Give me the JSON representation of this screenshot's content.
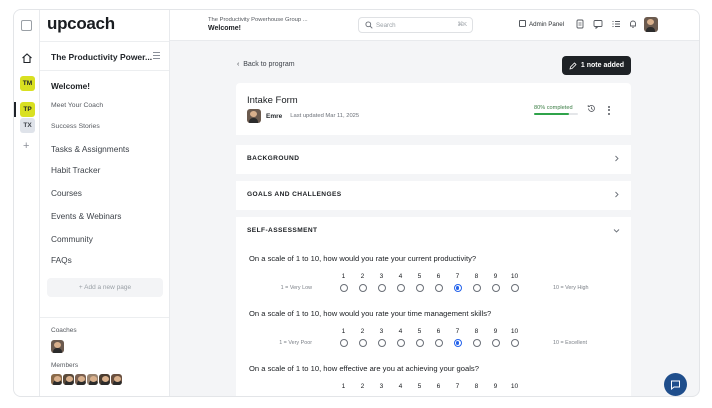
{
  "brand": "upcoach",
  "workspaces": [
    {
      "label": "TM",
      "bg": "#d9e021",
      "fg": "#1f2328"
    },
    {
      "label": "TP",
      "bg": "#d9e021",
      "fg": "#1f2328"
    },
    {
      "label": "TX",
      "bg": "#dfe3ea",
      "fg": "#3d4249"
    }
  ],
  "sidebar": {
    "program_title": "The Productivity Power...",
    "items": [
      {
        "label": "Welcome!"
      },
      {
        "label": "Meet Your Coach"
      },
      {
        "label": "Success Stories"
      },
      {
        "label": "Tasks & Assignments"
      },
      {
        "label": "Habit Tracker"
      },
      {
        "label": "Courses"
      },
      {
        "label": "Events & Webinars"
      },
      {
        "label": "Community"
      },
      {
        "label": "FAQs"
      }
    ],
    "add_page": "+ Add a new page",
    "coaches_label": "Coaches",
    "members_label": "Members"
  },
  "topbar": {
    "group": "The Productivity Powerhouse Group ...",
    "page": "Welcome!",
    "search_placeholder": "Search",
    "search_shortcut": "⌘K",
    "admin_panel": "Admin Panel"
  },
  "main": {
    "back": "Back to program",
    "note_button": "1 note added",
    "form_title": "Intake Form",
    "author": "Emre",
    "updated": "Last updated Mar 11, 2025",
    "progress_text": "80% completed",
    "progress": 0.8,
    "sections": [
      {
        "title": "BACKGROUND",
        "expanded": false
      },
      {
        "title": "GOALS AND CHALLENGES",
        "expanded": false
      },
      {
        "title": "SELF-ASSESSMENT",
        "expanded": true
      }
    ],
    "scale": [
      "1",
      "2",
      "3",
      "4",
      "5",
      "6",
      "7",
      "8",
      "9",
      "10"
    ],
    "questions": [
      {
        "text": "On a scale of 1 to 10, how would you rate your current productivity?",
        "low": "1 = Very Low",
        "high": "10 = Very High",
        "selected": 7
      },
      {
        "text": "On a scale of 1 to 10, how would you rate your time management skills?",
        "low": "1 = Very Poor",
        "high": "10 = Excellent",
        "selected": 7
      },
      {
        "text": "On a scale of 1 to 10, how effective are you at achieving your goals?",
        "low": "",
        "high": "",
        "selected": null
      }
    ]
  },
  "colors": {
    "accent": "#2563eb",
    "progress": "#2fa34a",
    "chat": "#1f4e8c",
    "workspace": "#d9e021"
  }
}
